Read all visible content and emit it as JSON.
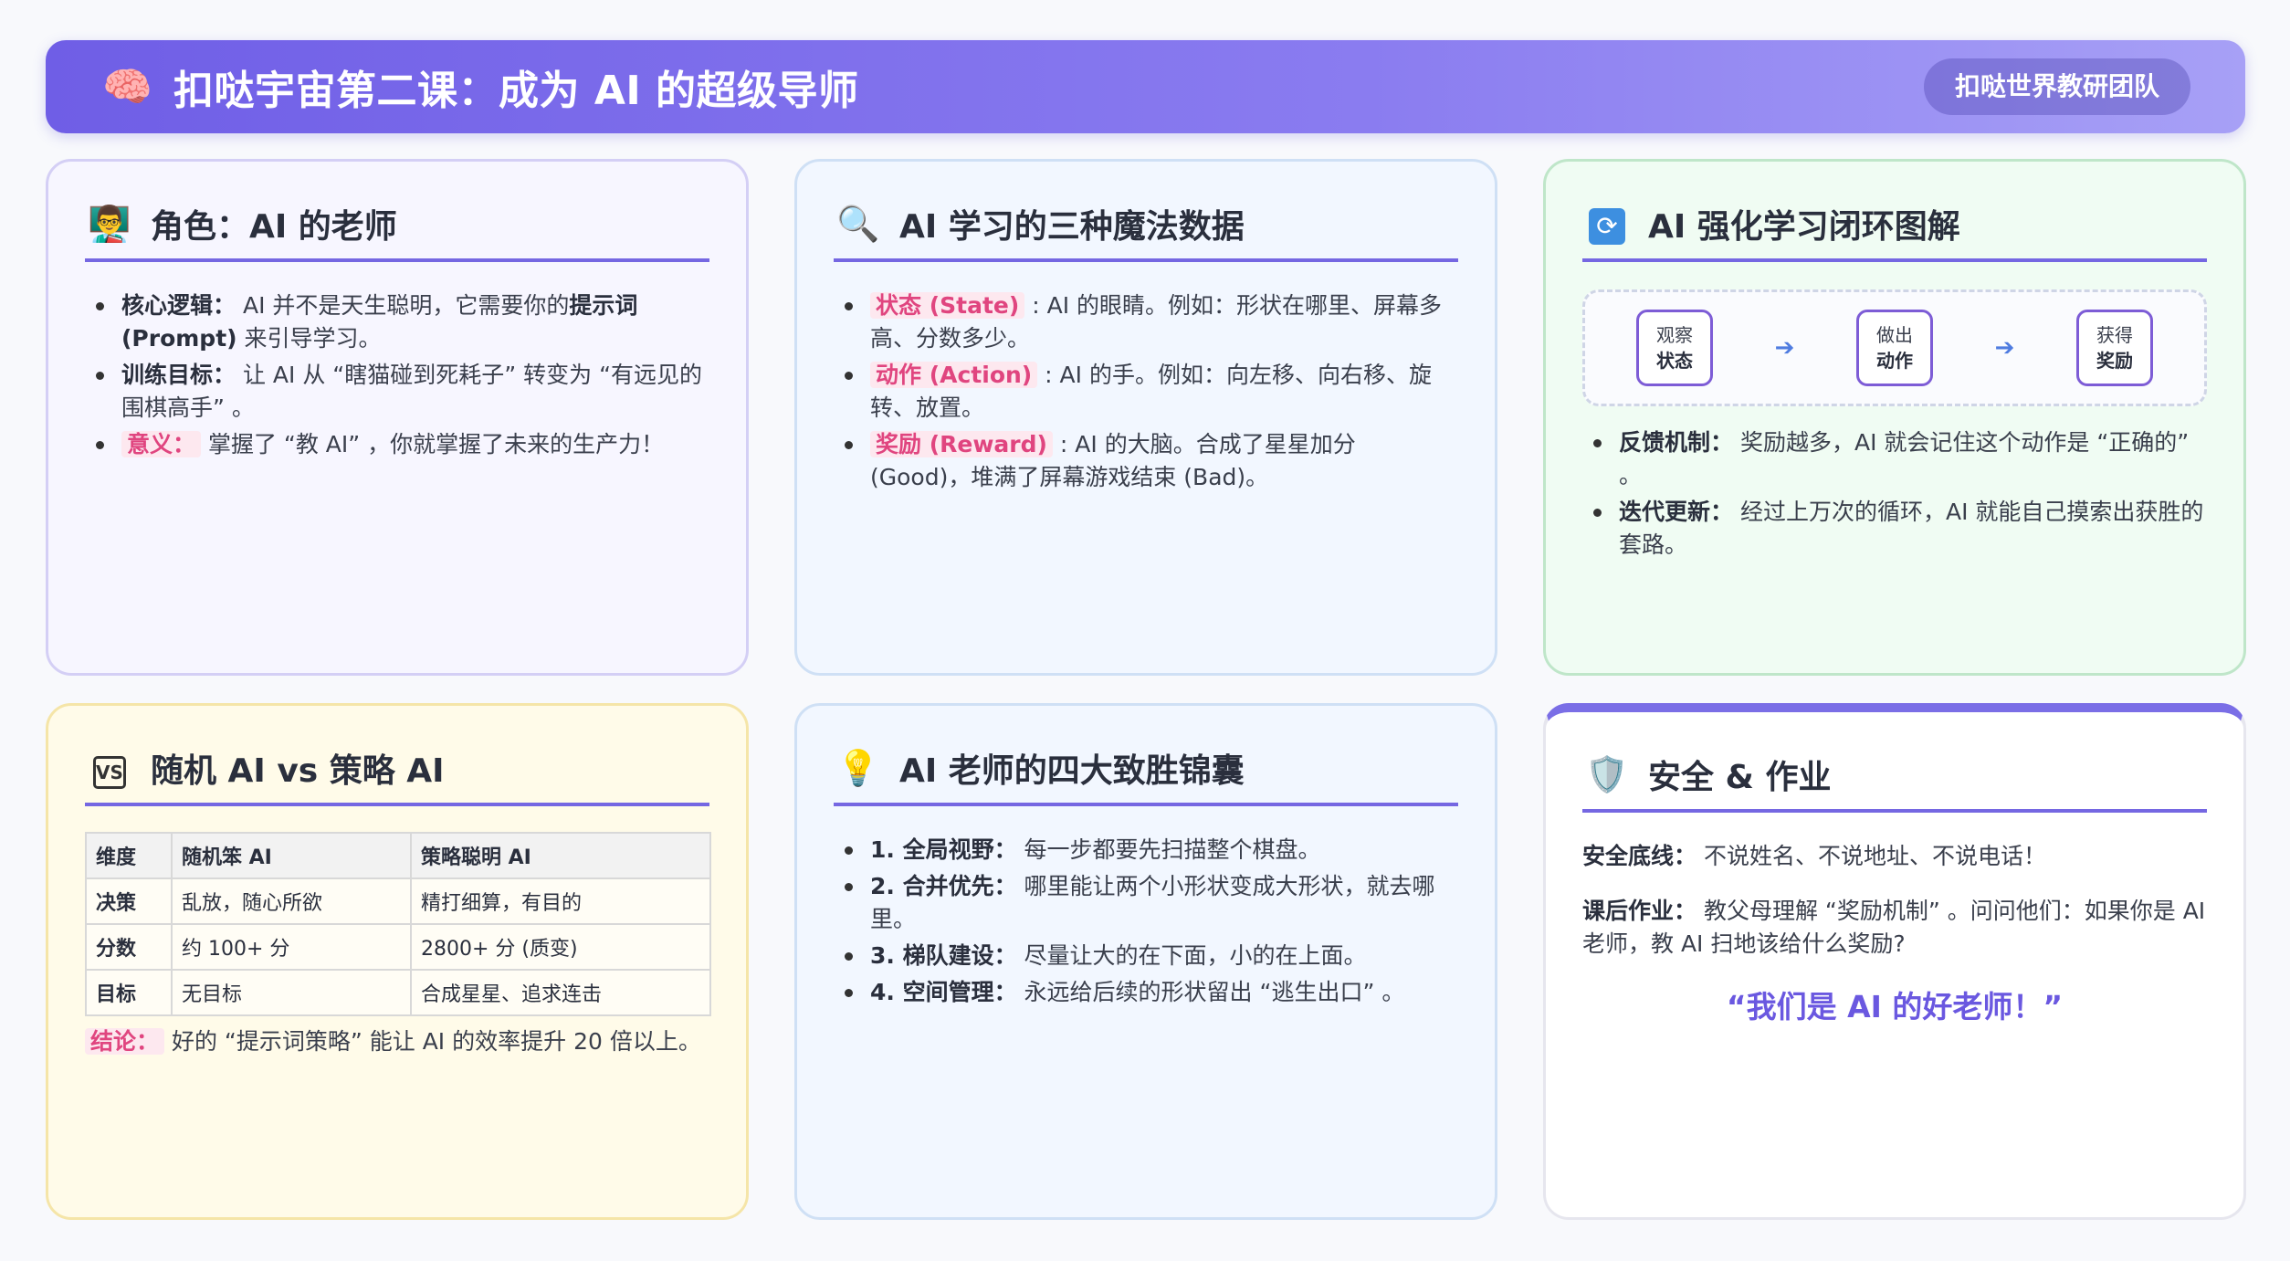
{
  "header": {
    "icon": "brain-icon",
    "title": "扣哒宇宙第二课：成为 AI 的超级导师",
    "team": "扣哒世界教研团队"
  },
  "role_card": {
    "icon": "teacher-icon",
    "title": "角色：AI 的老师",
    "items": [
      {
        "label": "核心逻辑：",
        "t1": " AI 并不是天生聪明，它需要你的",
        "bold": "提示词 (Prompt)",
        "t2": " 来引导学习。"
      },
      {
        "label": "训练目标：",
        "text": " 让 AI 从 “瞎猫碰到死耗子” 转变为 “有远见的围棋高手” 。"
      },
      {
        "label": "意义：",
        "text": " 掌握了 “教 AI” ，你就掌握了未来的生产力！"
      }
    ]
  },
  "data_card": {
    "icon": "magnifier-icon",
    "title": "AI 学习的三种魔法数据",
    "items": [
      {
        "label": "状态 (State)",
        "text": " : AI 的眼睛。例如：形状在哪里、屏幕多高、分数多少。"
      },
      {
        "label": "动作 (Action)",
        "text": " : AI 的手。例如：向左移、向右移、旋转、放置。"
      },
      {
        "label": "奖励 (Reward)",
        "text": " : AI 的大脑。合成了星星加分 (Good)，堆满了屏幕游戏结束 (Bad)。"
      }
    ]
  },
  "loop_card": {
    "icon": "cycle-icon",
    "title": "AI 强化学习闭环图解",
    "steps": [
      {
        "top": "观察",
        "bottom": "状态"
      },
      {
        "top": "做出",
        "bottom": "动作"
      },
      {
        "top": "获得",
        "bottom": "奖励"
      }
    ],
    "arrow": "➔",
    "items": [
      {
        "label": "反馈机制：",
        "text": " 奖励越多，AI 就会记住这个动作是 “正确的” 。"
      },
      {
        "label": "迭代更新：",
        "text": " 经过上万次的循环，AI 就能自己摸索出获胜的套路。"
      }
    ]
  },
  "compare_card": {
    "icon": "vs-icon",
    "icon_text": "VS",
    "title": "随机 AI vs 策略 AI",
    "headers": [
      "维度",
      "随机笨 AI",
      "策略聪明 AI"
    ],
    "rows": [
      [
        "决策",
        "乱放，随心所欲",
        "精打细算，有目的"
      ],
      [
        "分数",
        "约 100+ 分",
        "2800+ 分 (质变)"
      ],
      [
        "目标",
        "无目标",
        "合成星星、追求连击"
      ]
    ],
    "conclusion_label": "结论：",
    "conclusion_text": " 好的 “提示词策略” 能让 AI 的效率提升 20 倍以上。"
  },
  "tips_card": {
    "icon": "lightbulb-icon",
    "title": "AI 老师的四大致胜锦囊",
    "items": [
      {
        "label": "1. 全局视野：",
        "text": " 每一步都要先扫描整个棋盘。"
      },
      {
        "label": "2. 合并优先：",
        "text": " 哪里能让两个小形状变成大形状，就去哪里。"
      },
      {
        "label": "3. 梯队建设：",
        "text": " 尽量让大的在下面，小的在上面。"
      },
      {
        "label": "4. 空间管理：",
        "text": " 永远给后续的形状留出 “逃生出口” 。"
      }
    ]
  },
  "safety_card": {
    "icon": "shield-icon",
    "title": "安全 & 作业",
    "safety_label": "安全底线：",
    "safety_text": " 不说姓名、不说地址、不说电话！",
    "homework_label": "课后作业：",
    "homework_text": " 教父母理解 “奖励机制” 。问问他们：如果你是 AI 老师，教 AI 扫地该给什么奖励?",
    "quote": "“我们是 AI 的好老师！”"
  },
  "colors": {
    "accent": "#7567e2",
    "highlight": "#e0457f",
    "quote": "#6a58e0"
  }
}
